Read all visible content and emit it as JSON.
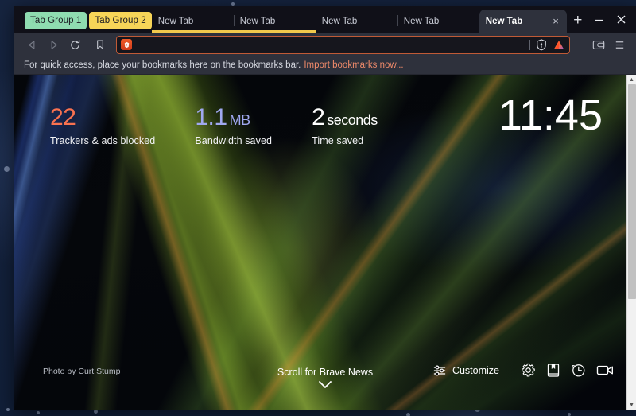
{
  "window": {
    "controls": {
      "minimize_label": "Minimize",
      "close_label": "Close"
    }
  },
  "tabstrip": {
    "groups": [
      {
        "name": "tab-group-1",
        "label": "Tab Group 1",
        "color": "#8fdcb0"
      },
      {
        "name": "tab-group-2",
        "label": "Tab Group 2",
        "color": "#f7d558"
      }
    ],
    "tabs": [
      {
        "label": "New Tab",
        "active": false,
        "grouped": true
      },
      {
        "label": "New Tab",
        "active": false,
        "grouped": true
      },
      {
        "label": "New Tab",
        "active": false,
        "grouped": false
      },
      {
        "label": "New Tab",
        "active": false,
        "grouped": false
      },
      {
        "label": "New Tab",
        "active": true,
        "grouped": false,
        "close_label": "×"
      }
    ],
    "new_tab_button_label": "+"
  },
  "navbar": {
    "back_icon": "back-arrow-icon",
    "forward_icon": "forward-arrow-icon",
    "reload_icon": "reload-icon",
    "bookmark_icon": "bookmark-icon",
    "url_value": "",
    "url_placeholder": "",
    "site_icon": "brave-lion-icon",
    "shields_icon": "brave-shields-icon",
    "rewards_icon": "brave-rewards-icon",
    "wallet_icon": "brave-wallet-icon",
    "menu_icon": "hamburger-menu-icon"
  },
  "bookmarks_bar": {
    "message": "For quick access, place your bookmarks here on the bookmarks bar.",
    "import_link": "Import bookmarks now..."
  },
  "new_tab_page": {
    "stats": [
      {
        "name": "trackers",
        "value": "22",
        "unit": "",
        "label": "Trackers & ads blocked",
        "color": "#fa7250"
      },
      {
        "name": "bandwidth",
        "value": "1.1",
        "unit": "MB",
        "label": "Bandwidth saved",
        "color": "#a0a8f0"
      },
      {
        "name": "time",
        "value": "2",
        "unit": "seconds",
        "label": "Time saved",
        "color": "#ffffff"
      }
    ],
    "clock": "11:45",
    "photo_credit": "Photo by Curt Stump",
    "scroll_news_label": "Scroll for Brave News",
    "toolbar": {
      "customize_label": "Customize",
      "customize_icon": "sliders-icon",
      "settings_icon": "gear-icon",
      "bookmarks_icon": "bookmarks-book-icon",
      "history_icon": "history-clock-icon",
      "talk_icon": "video-camera-icon"
    }
  }
}
